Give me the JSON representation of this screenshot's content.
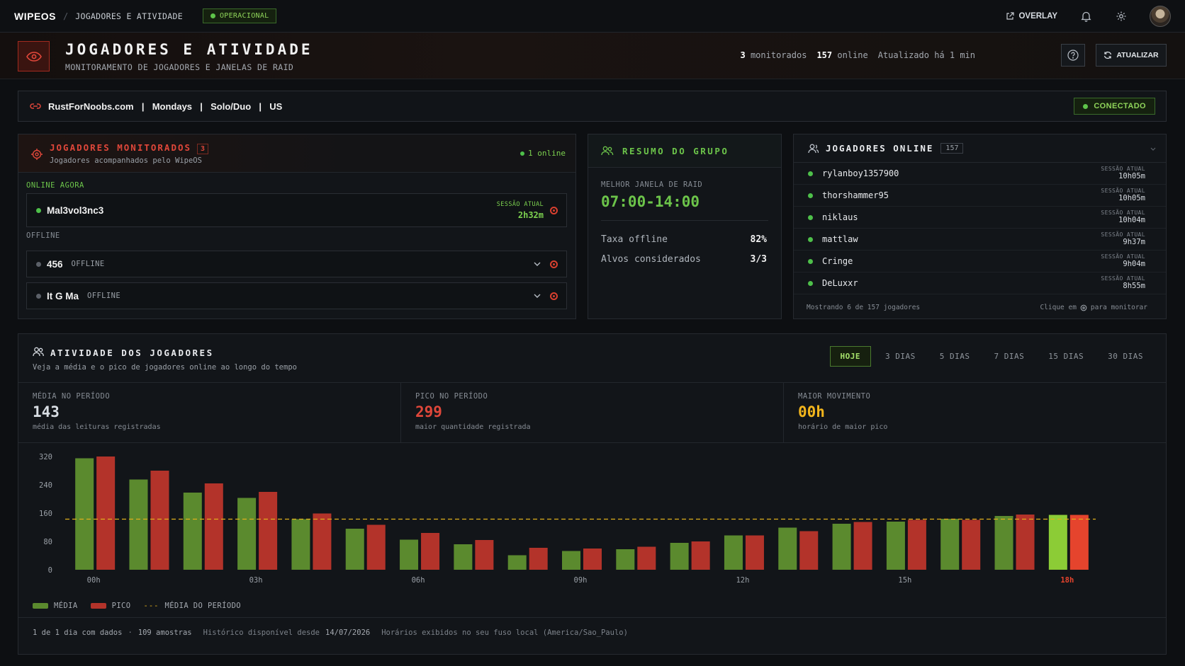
{
  "nav": {
    "brand": "WIPEOS",
    "separator": "/",
    "crumb": "JOGADORES E ATIVIDADE",
    "status": "OPERACIONAL",
    "overlay": "OVERLAY"
  },
  "header": {
    "title": "JOGADORES E ATIVIDADE",
    "subtitle": "MONITORAMENTO DE JOGADORES E JANELAS DE RAID",
    "monitored_count": "3",
    "monitored_label": "monitorados",
    "online_count": "157",
    "online_label": "online",
    "updated": "Atualizado há 1 min",
    "refresh_label": "ATUALIZAR"
  },
  "server": {
    "info": "RustForNoobs.com  |  Mondays  |  Solo/Duo  |  US",
    "status": "CONECTADO"
  },
  "monitored": {
    "title": "JOGADORES MONITORADOS",
    "count": "3",
    "subtitle": "Jogadores acompanhados pelo WipeOS",
    "online_tag": "1 online",
    "online_section": "ONLINE AGORA",
    "offline_section": "OFFLINE",
    "online_players": [
      {
        "name": "Mal3vol3nc3",
        "session_label": "SESSÃO ATUAL",
        "session": "2h32m"
      }
    ],
    "offline_players": [
      {
        "name": "456",
        "status": "OFFLINE"
      },
      {
        "name": "It G Ma",
        "status": "OFFLINE"
      }
    ]
  },
  "group": {
    "title": "RESUMO DO GRUPO",
    "best_window_label": "MELHOR JANELA DE RAID",
    "best_window": "07:00-14:00",
    "offline_rate_label": "Taxa offline",
    "offline_rate": "82%",
    "targets_label": "Alvos considerados",
    "targets": "3/3"
  },
  "online": {
    "title": "JOGADORES ONLINE",
    "count": "157",
    "players": [
      {
        "name": "rylanboy1357900",
        "session_label": "SESSÃO ATUAL",
        "session": "10h05m"
      },
      {
        "name": "thorshammer95",
        "session_label": "SESSÃO ATUAL",
        "session": "10h05m"
      },
      {
        "name": "niklaus",
        "session_label": "SESSÃO ATUAL",
        "session": "10h04m"
      },
      {
        "name": "mattlaw",
        "session_label": "SESSÃO ATUAL",
        "session": "9h37m"
      },
      {
        "name": "Cringe",
        "session_label": "SESSÃO ATUAL",
        "session": "9h04m"
      },
      {
        "name": "DeLuxxr",
        "session_label": "SESSÃO ATUAL",
        "session": "8h55m"
      }
    ],
    "footer_left": "Mostrando 6 de 157 jogadores",
    "footer_right_a": "Clique em",
    "footer_right_b": "para monitorar"
  },
  "activity": {
    "title": "ATIVIDADE DOS JOGADORES",
    "subtitle": "Veja a média e o pico de jogadores online ao longo do tempo",
    "ranges": [
      "HOJE",
      "3 DIAS",
      "5 DIAS",
      "7 DIAS",
      "15 DIAS",
      "30 DIAS"
    ],
    "active_range": "HOJE",
    "stats": [
      {
        "label": "MÉDIA NO PERÍODO",
        "value": "143",
        "desc": "média das leituras registradas",
        "color": "#d8dde3"
      },
      {
        "label": "PICO NO PERÍODO",
        "value": "299",
        "desc": "maior quantidade registrada",
        "color": "#e0473a"
      },
      {
        "label": "MAIOR MOVIMENTO",
        "value": "00h",
        "desc": "horário de maior pico",
        "color": "#f2b51c"
      }
    ],
    "legend": {
      "media": "MÉDIA",
      "pico": "PICO",
      "period_avg": "MÉDIA DO PERÍODO"
    },
    "footer": {
      "days": "1 de 1 dia com dados",
      "dot": "·",
      "samples": "109 amostras",
      "history_label": "Histórico disponível desde",
      "history_date": "14/07/2026",
      "tz": "Horários exibidos no seu fuso local (America/Sao_Paulo)"
    }
  },
  "chart_data": {
    "type": "bar",
    "categories": [
      "00h",
      "01h",
      "02h",
      "03h",
      "04h",
      "05h",
      "06h",
      "07h",
      "08h",
      "09h",
      "10h",
      "11h",
      "12h",
      "13h",
      "14h",
      "15h",
      "16h",
      "17h",
      "18h"
    ],
    "x_tick_labels": [
      "00h",
      "03h",
      "06h",
      "09h",
      "12h",
      "15h",
      "18h"
    ],
    "highlight_tick": "18h",
    "series": [
      {
        "name": "MÉDIA",
        "color": "#5b8a2e",
        "values": [
          315,
          255,
          218,
          203,
          143,
          116,
          85,
          72,
          41,
          53,
          58,
          76,
          97,
          119,
          130,
          136,
          144,
          152,
          155
        ]
      },
      {
        "name": "PICO",
        "color": "#b3332a",
        "values": [
          320,
          280,
          244,
          220,
          159,
          127,
          104,
          84,
          62,
          60,
          65,
          80,
          97,
          109,
          135,
          141,
          141,
          156,
          155
        ]
      }
    ],
    "period_average": 143,
    "y_ticks": [
      0,
      80,
      160,
      240,
      320
    ],
    "ylim": [
      0,
      320
    ],
    "highlight_colors": {
      "media": "#8ccc36",
      "pico": "#e5442d"
    }
  }
}
